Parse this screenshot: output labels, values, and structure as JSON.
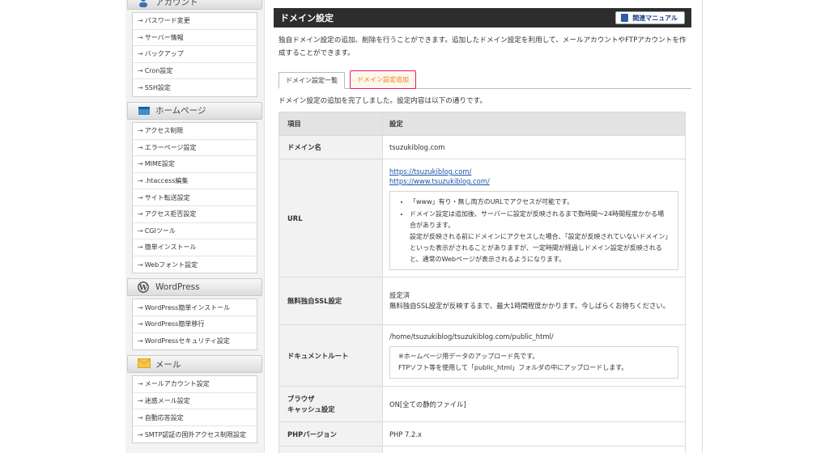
{
  "sidebar": {
    "account": {
      "title": "アカウント",
      "items": [
        "パスワード変更",
        "サーバー情報",
        "バックアップ",
        "Cron設定",
        "SSH設定"
      ]
    },
    "homepage": {
      "title": "ホームページ",
      "items": [
        "アクセス制限",
        "エラーページ設定",
        "MIME設定",
        ".htaccess編集",
        "サイト転送設定",
        "アクセス拒否設定",
        "CGIツール",
        "簡単インストール",
        "Webフォント設定"
      ]
    },
    "wordpress": {
      "title": "WordPress",
      "items": [
        "WordPress簡単インストール",
        "WordPress簡単移行",
        "WordPressセキュリティ設定"
      ]
    },
    "mail": {
      "title": "メール",
      "items": [
        "メールアカウント設定",
        "迷惑メール設定",
        "自動応答設定",
        "SMTP認証の国外アクセス制限設定"
      ]
    }
  },
  "main": {
    "title": "ドメイン設定",
    "manual_button": "関連マニュアル",
    "intro": "独自ドメイン設定の追加、削除を行うことができます。追加したドメイン設定を利用して、メールアカウントやFTPアカウントを作成することができます。",
    "tabs": [
      "ドメイン設定一覧",
      "ドメイン設定追加"
    ],
    "done_message": "ドメイン設定の追加を完了しました。設定内容は以下の通りです。",
    "table": {
      "header": {
        "key": "項目",
        "value": "設定"
      },
      "domain": {
        "key": "ドメイン名",
        "value": "tsuzukiblog.com"
      },
      "url": {
        "key": "URL",
        "links": [
          "https://tsuzukiblog.com/",
          "https://www.tsuzukiblog.com/"
        ],
        "notes": [
          "「www」有り・無し両方のURLでアクセスが可能です。",
          "ドメイン設定は追加後、サーバーに設定が反映されるまで数時間〜24時間程度かかる場合があります。\n設定が反映される前にドメインにアクセスした場合、「設定が反映されていないドメイン」といった表示がされることがありますが、一定時間が経過しドメイン設定が反映されると、通常のWebページが表示されるようになります。"
        ]
      },
      "ssl": {
        "key": "無料独自SSL設定",
        "status": "設定済",
        "note": "無料独自SSL設定が反映するまで、最大1時間程度かかります。今しばらくお待ちください。"
      },
      "docroot": {
        "key": "ドキュメントルート",
        "path": "/home/tsuzukiblog/tsuzukiblog.com/public_html/",
        "note1": "※ホームページ用データのアップロード先です。",
        "note2": "FTPソフト等を使用して「public_html」フォルダの中にアップロードします。"
      },
      "cache": {
        "key_line1": "ブラウザ",
        "key_line2": "キャッシュ設定",
        "value": "ON[全ての静的ファイル]"
      },
      "php": {
        "key": "PHPバージョン",
        "value": "PHP 7.2.x"
      }
    }
  }
}
